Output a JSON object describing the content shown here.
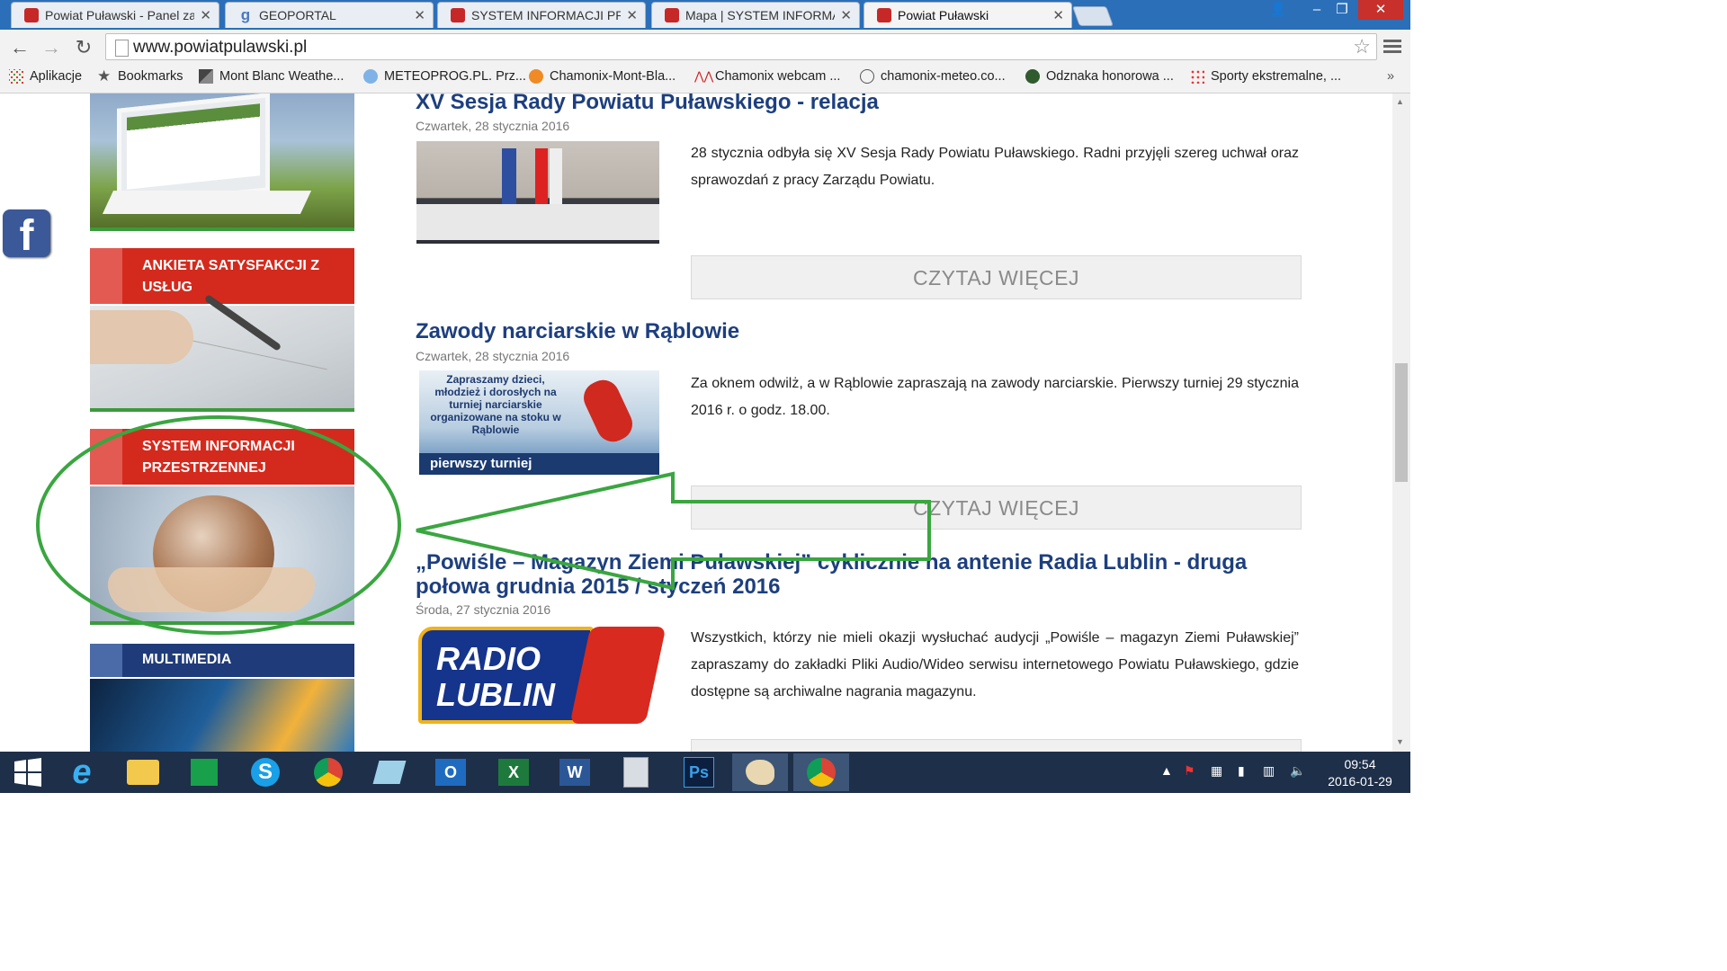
{
  "tabs": [
    {
      "title": "Powiat Puławski - Panel za",
      "favicon": "shield-icon"
    },
    {
      "title": "GEOPORTAL",
      "favicon": "g-icon"
    },
    {
      "title": "SYSTEM INFORMACJI PRZ",
      "favicon": "shield-icon"
    },
    {
      "title": "Mapa | SYSTEM INFORMA",
      "favicon": "shield-icon"
    },
    {
      "title": "Powiat Puławski",
      "favicon": "shield-icon",
      "active": true
    }
  ],
  "address_bar": {
    "url": "www.powiatpulawski.pl"
  },
  "bookmarks": [
    {
      "label": "Aplikacje",
      "icon": "apps-grid-icon"
    },
    {
      "label": "Bookmarks",
      "icon": "star-icon"
    },
    {
      "label": "Mont Blanc Weathe...",
      "icon": "mountain-icon"
    },
    {
      "label": "METEOPROG.PL. Prz...",
      "icon": "weather-icon"
    },
    {
      "label": "Chamonix-Mont-Bla...",
      "icon": "sun-icon"
    },
    {
      "label": "Chamonix webcam ...",
      "icon": "webcam-icon"
    },
    {
      "label": "chamonix-meteo.co...",
      "icon": "compass-icon"
    },
    {
      "label": "Odznaka honorowa ...",
      "icon": "badge-icon"
    },
    {
      "label": "Sporty ekstremalne, ...",
      "icon": "dots-icon"
    }
  ],
  "sidebar": {
    "ankieta": "ANKIETA SATYSFAKCJI Z USŁUG",
    "system": "SYSTEM INFORMACJI PRZESTRZENNEJ",
    "multimedia": "MULTIMEDIA"
  },
  "articles": [
    {
      "title": "XV Sesja Rady Powiatu Puławskiego - relacja",
      "date": "Czwartek, 28 stycznia 2016",
      "text": "28 stycznia odbyła się XV Sesja Rady Powiatu Puławskiego. Radni przyjęli szereg uchwał oraz sprawozdań z pracy Zarządu Powiatu.",
      "more": "CZYTAJ WIĘCEJ"
    },
    {
      "title": "Zawody narciarskie w Rąblowie",
      "date": "Czwartek, 28 stycznia 2016",
      "text": "Za oknem odwilż, a w Rąblowie zapraszają na zawody narciarskie. Pierwszy turniej 29 stycznia 2016 r. o godz. 18.00.",
      "more": "CZYTAJ WIĘCEJ",
      "image_text": "Zapraszamy dzieci, młodzież i dorosłych na turniej narciarskie organizowane na stoku w Rąblowie",
      "image_banner": "pierwszy turniej"
    },
    {
      "title": "„Powiśle – Magazyn Ziemi Puławskiej” cyklicznie na antenie Radia Lublin - druga połowa grudnia 2015 / styczeń 2016",
      "date": "Środa, 27 stycznia 2016",
      "text": "Wszystkich, którzy nie mieli okazji wysłuchać audycji „Powiśle – magazyn Ziemi Puławskiej” zapraszamy do zakładki Pliki Audio/Wideo serwisu internetowego Powiatu Puławskiego, gdzie dostępne są archiwalne nagrania magazynu.",
      "logo_text": "RADIO LUBLIN"
    }
  ],
  "taskbar": {
    "apps": [
      "windows-start-icon",
      "ie-icon",
      "explorer-icon",
      "store-icon",
      "skype-icon",
      "chrome-icon",
      "notepad-icon",
      "outlook-icon",
      "excel-icon",
      "word-icon",
      "calculator-icon",
      "photoshop-icon",
      "paint-icon",
      "chrome-icon"
    ],
    "time": "09:54",
    "date": "2016-01-29"
  },
  "colors": {
    "accent_red": "#d42a1d",
    "title_blue": "#1d3f7f",
    "annotation_green": "#3aa640",
    "chrome_frame": "#2b6fb8"
  }
}
